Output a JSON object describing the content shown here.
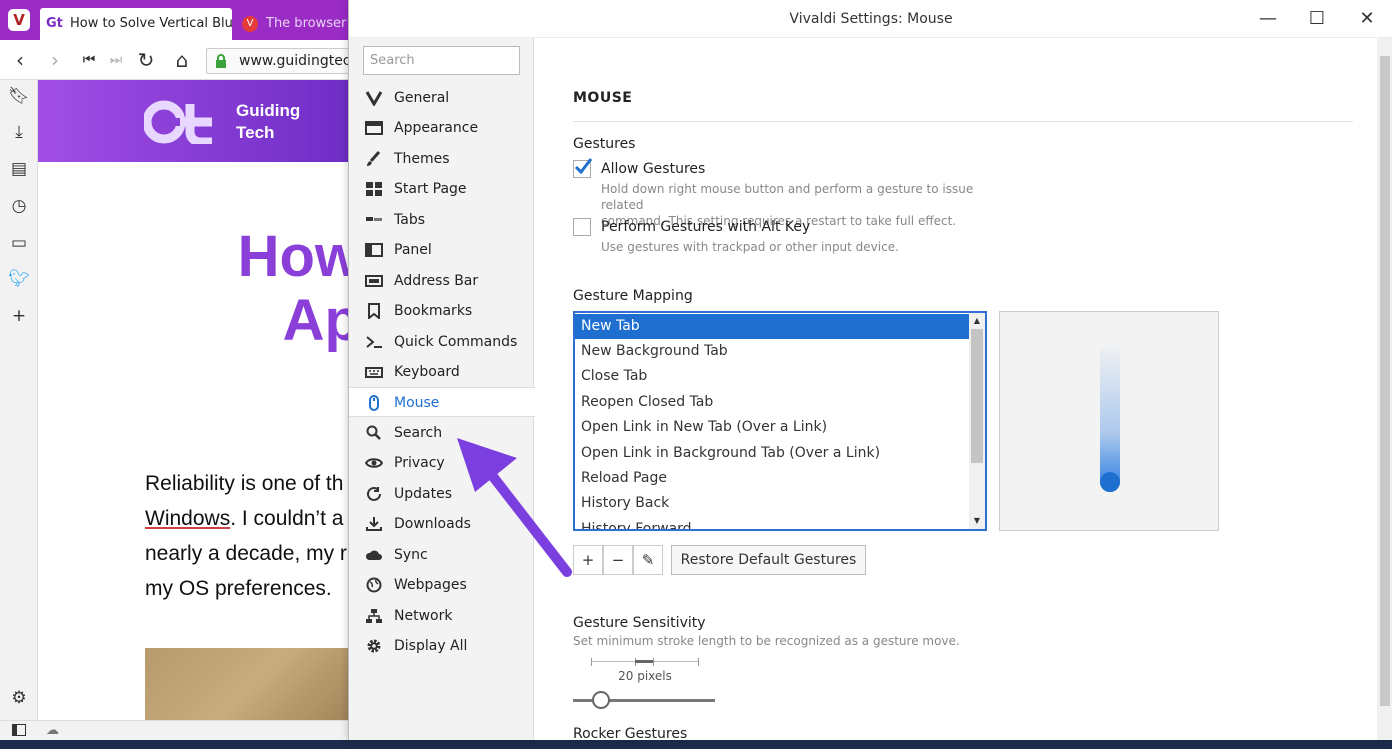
{
  "browser": {
    "tabs": [
      {
        "label": "How to Solve Vertical Blue L",
        "favicon": "gt-favicon-icon"
      },
      {
        "label": "The browser th",
        "favicon": "vivaldi-favicon-icon"
      }
    ],
    "url": "www.guidingtech",
    "site_name": "Guiding\nTech",
    "site_name_line1": "Guiding",
    "site_name_line2": "Tech",
    "article_title_line1": "How",
    "article_title_line2": "Ap",
    "article_lines": [
      "Reliability is one of th",
      "Windows",
      ". I couldn’t a",
      "nearly a decade, my r",
      "my OS preferences."
    ],
    "header_gradient": [
      "#a14ee6",
      "#6d2cc4"
    ]
  },
  "window": {
    "title": "Vivaldi Settings: Mouse",
    "minimize": "—",
    "maximize": "☐",
    "close": "✕"
  },
  "sidebar": {
    "search_placeholder": "Search",
    "items": [
      {
        "label": "General",
        "icon": "vivaldi-v-icon"
      },
      {
        "label": "Appearance",
        "icon": "window-icon"
      },
      {
        "label": "Themes",
        "icon": "brush-icon"
      },
      {
        "label": "Start Page",
        "icon": "grid-icon"
      },
      {
        "label": "Tabs",
        "icon": "tabs-icon"
      },
      {
        "label": "Panel",
        "icon": "panel-icon"
      },
      {
        "label": "Address Bar",
        "icon": "address-bar-icon"
      },
      {
        "label": "Bookmarks",
        "icon": "bookmark-icon"
      },
      {
        "label": "Quick Commands",
        "icon": "quick-commands-icon"
      },
      {
        "label": "Keyboard",
        "icon": "keyboard-icon"
      },
      {
        "label": "Mouse",
        "icon": "mouse-icon",
        "active": true
      },
      {
        "label": "Search",
        "icon": "search-icon"
      },
      {
        "label": "Privacy",
        "icon": "eye-icon"
      },
      {
        "label": "Updates",
        "icon": "refresh-icon"
      },
      {
        "label": "Downloads",
        "icon": "download-icon"
      },
      {
        "label": "Sync",
        "icon": "cloud-icon"
      },
      {
        "label": "Webpages",
        "icon": "globe-icon"
      },
      {
        "label": "Network",
        "icon": "network-icon"
      },
      {
        "label": "Display All",
        "icon": "gear-icon"
      }
    ]
  },
  "mouse": {
    "heading": "MOUSE",
    "gestures_heading": "Gestures",
    "allow_gestures": {
      "label": "Allow Gestures",
      "checked": true,
      "desc_line1": "Hold down right mouse button and perform a gesture to issue related",
      "desc_line2": "command. This setting requires a restart to take full effect."
    },
    "alt_key": {
      "label": "Perform Gestures with Alt Key",
      "checked": false,
      "desc": "Use gestures with trackpad or other input device."
    },
    "mapping_heading": "Gesture Mapping",
    "mapping_items": [
      "New Tab",
      "New Background Tab",
      "Close Tab",
      "Reopen Closed Tab",
      "Open Link in New Tab (Over a Link)",
      "Open Link in Background Tab (Over a Link)",
      "Reload Page",
      "History Back",
      "History Forward"
    ],
    "selected_index": 0,
    "add_label": "+",
    "remove_label": "−",
    "edit_label": "✎",
    "restore_label": "Restore Default Gestures",
    "sensitivity_heading": "Gesture Sensitivity",
    "sensitivity_desc": "Set minimum stroke length to be recognized as a gesture move.",
    "sensitivity_value": "20 pixels",
    "rocker_heading": "Rocker Gestures"
  },
  "colors": {
    "accent": "#1f6fd1",
    "tabstrip": "#9a2bc5",
    "arrow": "#7b3fe0"
  }
}
